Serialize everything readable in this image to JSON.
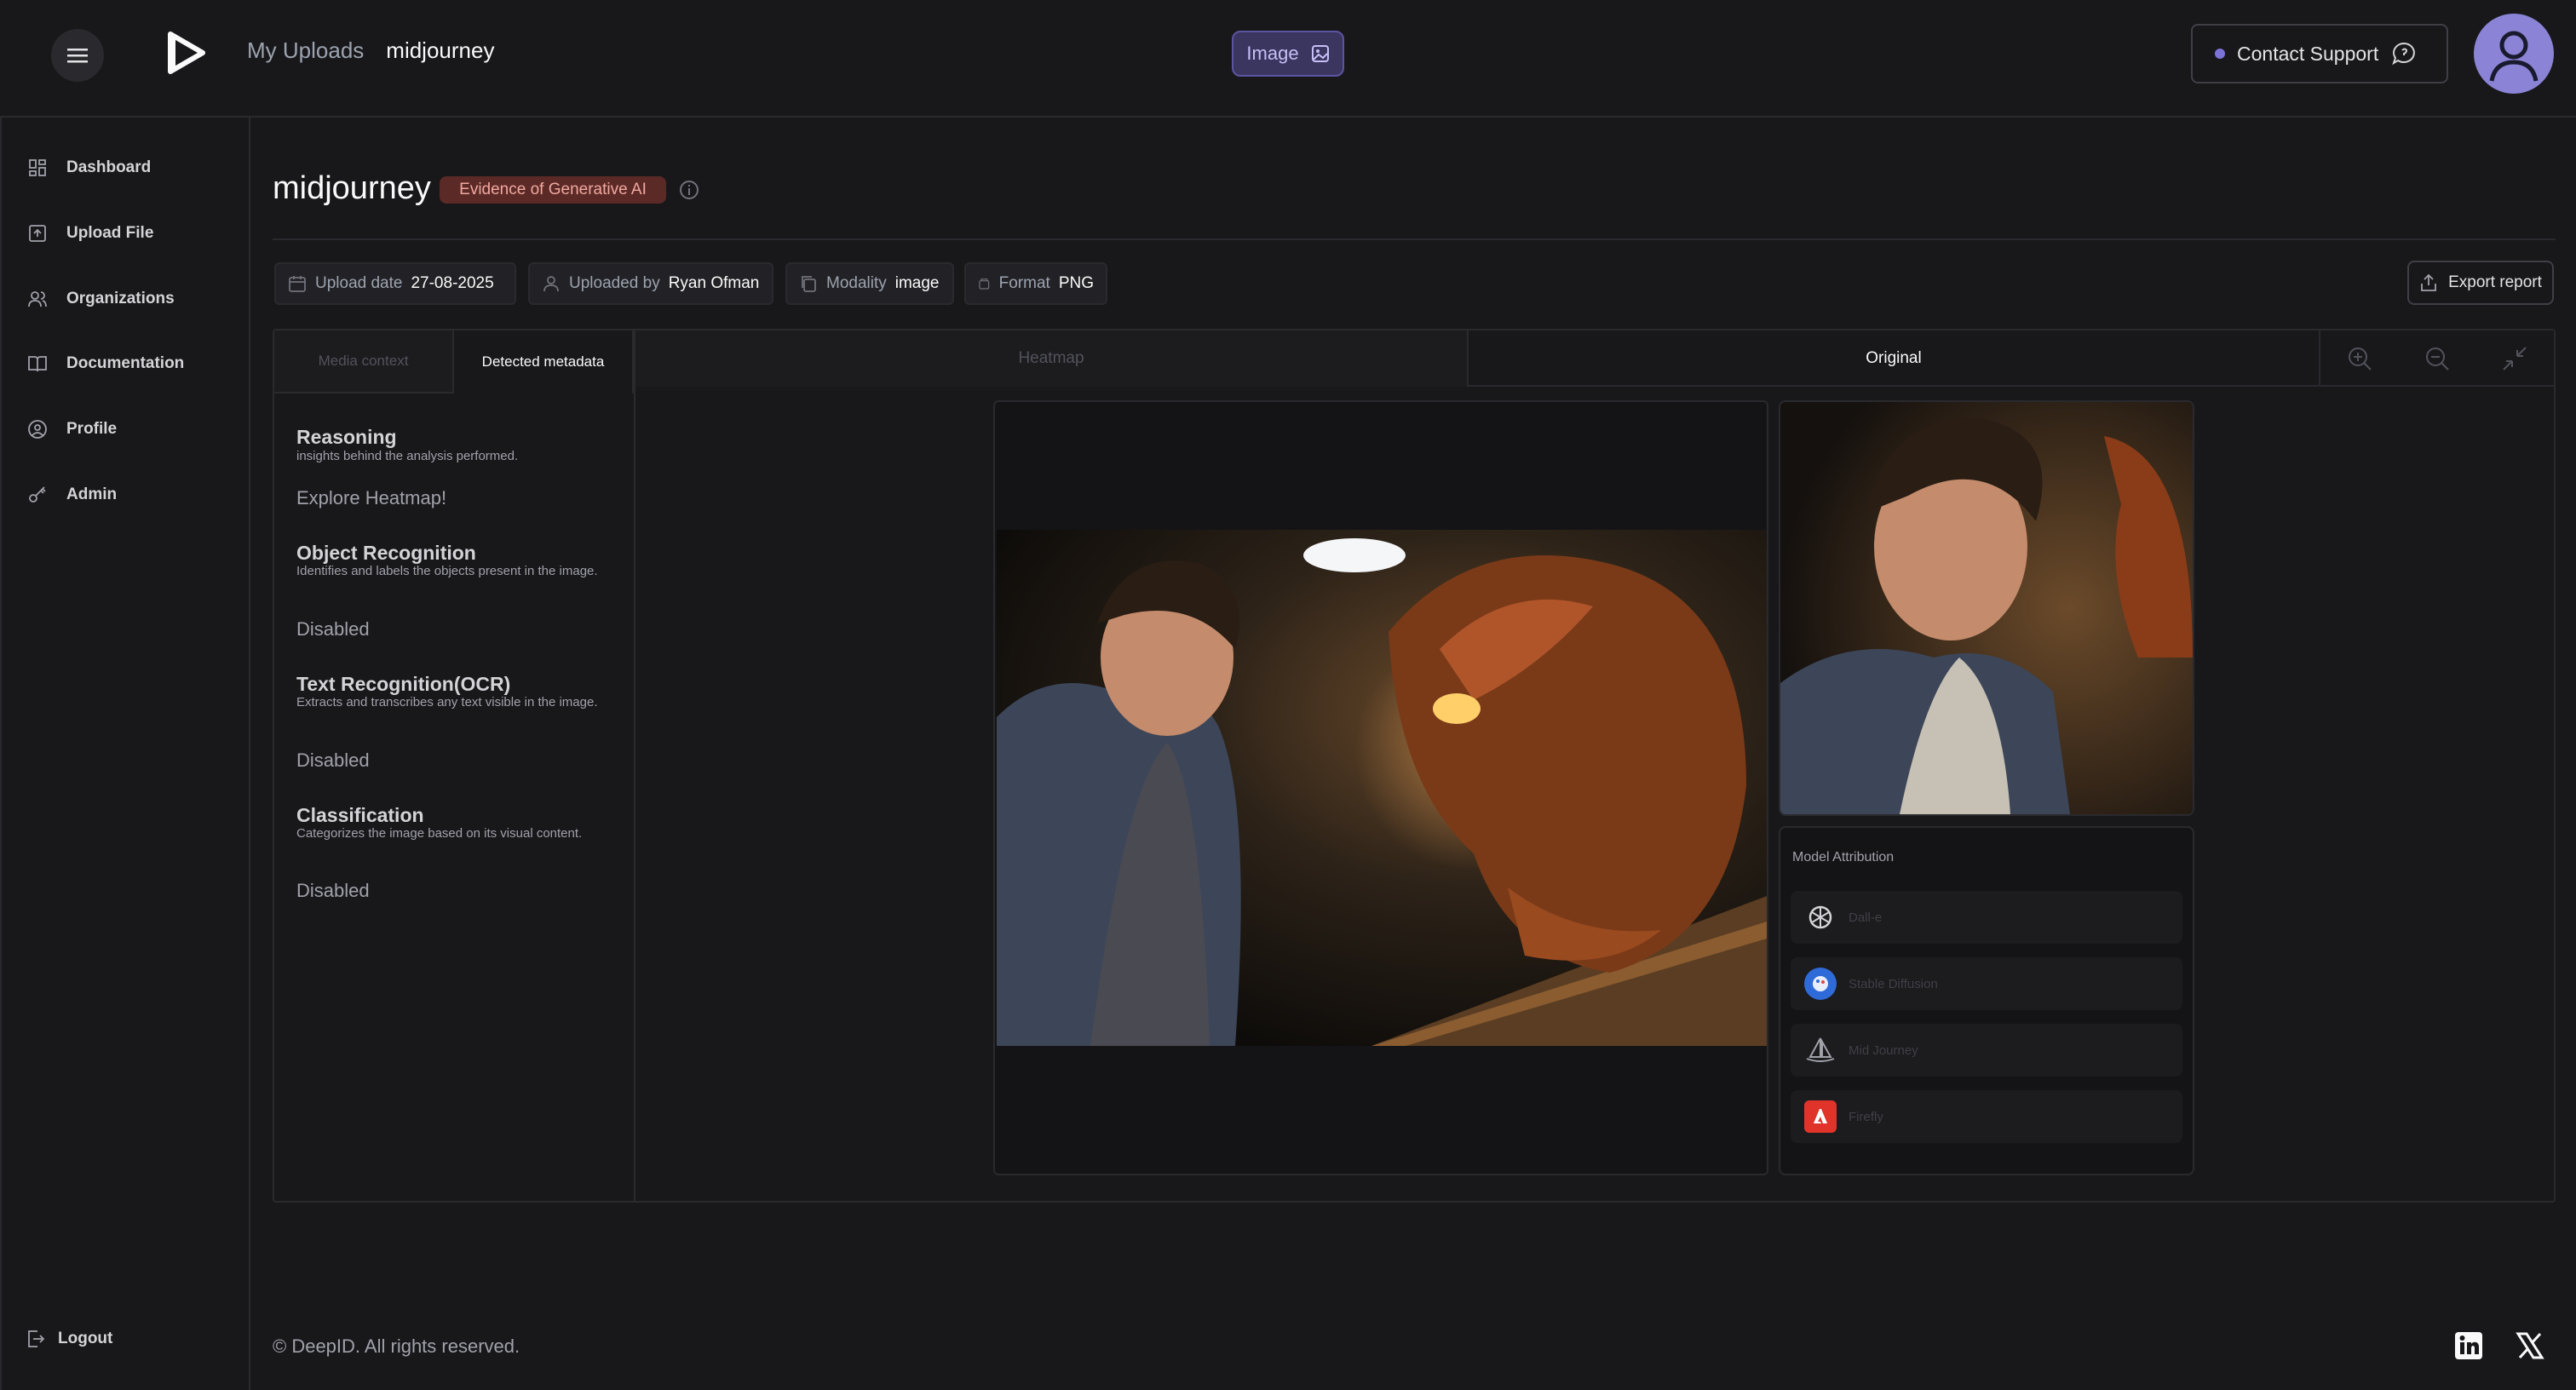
{
  "header": {
    "breadcrumb": [
      "My Uploads",
      "midjourney"
    ],
    "modality_badge": "Image",
    "support_label": "Contact Support"
  },
  "sidebar": {
    "items": [
      {
        "label": "Dashboard",
        "icon": "grid-icon"
      },
      {
        "label": "Upload File",
        "icon": "upload-icon"
      },
      {
        "label": "Organizations",
        "icon": "users-icon"
      },
      {
        "label": "Documentation",
        "icon": "book-icon"
      },
      {
        "label": "Profile",
        "icon": "user-circle-icon"
      },
      {
        "label": "Admin",
        "icon": "key-icon"
      }
    ],
    "logout": "Logout"
  },
  "page": {
    "title": "midjourney",
    "verdict_badge": "Evidence of Generative AI",
    "meta": {
      "upload_date_label": "Upload date",
      "upload_date": "27-08-2025",
      "uploaded_by_label": "Uploaded by",
      "uploaded_by": "Ryan Ofman",
      "modality_label": "Modality",
      "modality": "image",
      "format_label": "Format",
      "format": "PNG"
    },
    "export_label": "Export report"
  },
  "left_tabs": [
    "Media context",
    "Detected metadata"
  ],
  "sections": [
    {
      "title": "Reasoning",
      "desc": "insights behind the analysis performed.",
      "value": "Explore Heatmap!"
    },
    {
      "title": "Object Recognition",
      "desc": "Identifies and labels the objects present in the image.",
      "value": "Disabled"
    },
    {
      "title": "Text Recognition(OCR)",
      "desc": "Extracts and transcribes any text visible in the image.",
      "value": "Disabled"
    },
    {
      "title": "Classification",
      "desc": "Categorizes the image based on its visual content.",
      "value": "Disabled"
    }
  ],
  "view_tabs": [
    "Heatmap",
    "Original"
  ],
  "attribution": {
    "title": "Model Attribution",
    "models": [
      "Dall-e",
      "Stable Diffusion",
      "Mid Journey",
      "Firefly"
    ]
  },
  "footer": {
    "copyright": "© DeepID. All rights reserved."
  },
  "colors": {
    "background": "#18181b",
    "accent": "#8b84d6",
    "verdict_bg": "#5b2a26",
    "verdict_text": "#f0a8a0"
  }
}
